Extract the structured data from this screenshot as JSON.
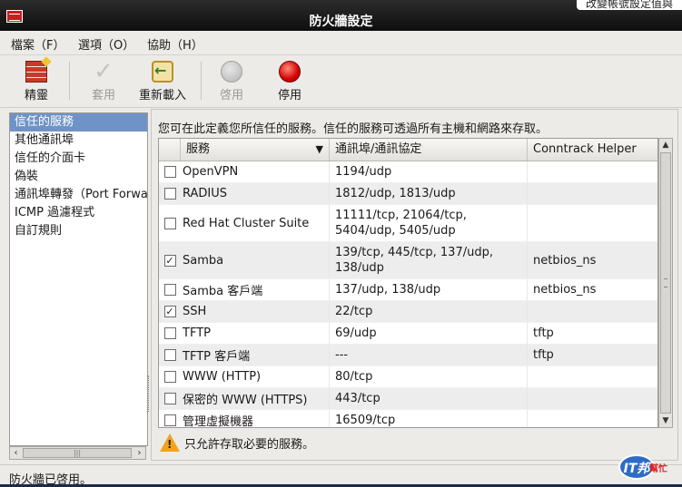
{
  "window": {
    "title": "防火牆設定",
    "tooltip": "改變帳號設定值與"
  },
  "menubar": {
    "items": [
      "檔案（F）",
      "選項（O）",
      "協助（H）"
    ]
  },
  "toolbar": {
    "buttons": [
      {
        "label": "精靈",
        "icon": "wizard-icon",
        "enabled": true
      },
      {
        "label": "套用",
        "icon": "apply-check-icon",
        "enabled": false
      },
      {
        "label": "重新載入",
        "icon": "reload-icon",
        "enabled": true
      },
      {
        "label": "啓用",
        "icon": "enable-circle-icon",
        "enabled": false
      },
      {
        "label": "停用",
        "icon": "disable-red-circle-icon",
        "enabled": true
      }
    ]
  },
  "sidebar": {
    "items": [
      {
        "label": "信任的服務",
        "selected": true
      },
      {
        "label": "其他通訊埠",
        "selected": false
      },
      {
        "label": "信任的介面卡",
        "selected": false
      },
      {
        "label": "偽裝",
        "selected": false
      },
      {
        "label": "通訊埠轉發（Port Forwa",
        "selected": false
      },
      {
        "label": "ICMP 過濾程式",
        "selected": false
      },
      {
        "label": "自訂規則",
        "selected": false
      }
    ]
  },
  "main": {
    "description": "您可在此定義您所信任的服務。信任的服務可透過所有主機和網路來存取。",
    "table": {
      "headers": {
        "service": "服務",
        "ports": "通訊埠/通訊協定",
        "helper": "Conntrack Helper"
      },
      "rows": [
        {
          "checked": false,
          "name": "OpenVPN",
          "ports": "1194/udp",
          "helper": ""
        },
        {
          "checked": false,
          "name": "RADIUS",
          "ports": "1812/udp, 1813/udp",
          "helper": ""
        },
        {
          "checked": false,
          "name": "Red Hat Cluster Suite",
          "ports": "11111/tcp, 21064/tcp, 5404/udp, 5405/udp",
          "helper": ""
        },
        {
          "checked": true,
          "name": "Samba",
          "ports": "139/tcp, 445/tcp, 137/udp, 138/udp",
          "helper": "netbios_ns"
        },
        {
          "checked": false,
          "name": "Samba 客戶端",
          "ports": "137/udp, 138/udp",
          "helper": "netbios_ns"
        },
        {
          "checked": true,
          "name": "SSH",
          "ports": "22/tcp",
          "helper": ""
        },
        {
          "checked": false,
          "name": "TFTP",
          "ports": "69/udp",
          "helper": "tftp"
        },
        {
          "checked": false,
          "name": "TFTP 客戶端",
          "ports": "---",
          "helper": "tftp"
        },
        {
          "checked": false,
          "name": "WWW (HTTP)",
          "ports": "80/tcp",
          "helper": ""
        },
        {
          "checked": false,
          "name": "保密的 WWW (HTTPS)",
          "ports": "443/tcp",
          "helper": ""
        },
        {
          "checked": false,
          "name": "管理虛擬機器",
          "ports": "16509/tcp",
          "helper": ""
        }
      ]
    },
    "warning": "只允許存取必要的服務。"
  },
  "statusbar": {
    "text": "防火牆已啓用。"
  },
  "watermark": {
    "logo_text": "IT邦",
    "logo_sub": "幫忙"
  },
  "colors": {
    "selection": "#6f93c6",
    "disable_red": "#d40000",
    "warning": "#f2a31a"
  }
}
